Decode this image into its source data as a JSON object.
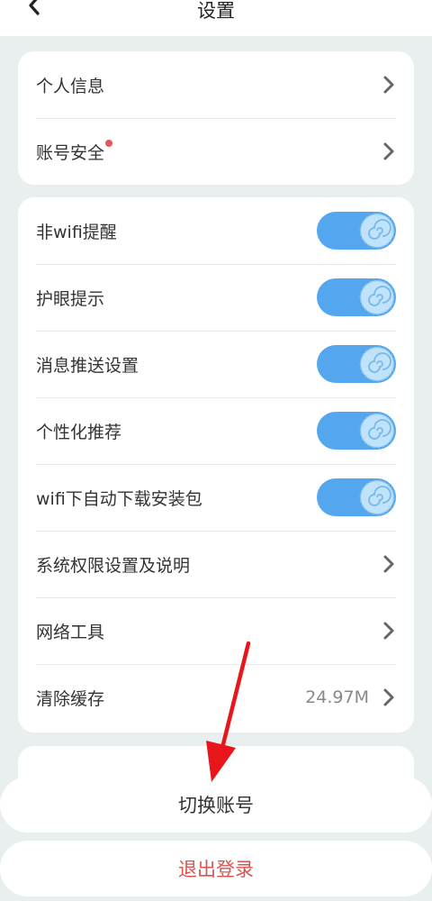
{
  "header": {
    "title": "设置",
    "back_icon": "chevron-left-icon"
  },
  "account_section": {
    "items": [
      {
        "label": "个人信息",
        "icon": "chevron-right-icon"
      },
      {
        "label": "账号安全",
        "icon": "chevron-right-icon",
        "badge": "red-dot"
      }
    ]
  },
  "settings_section": {
    "toggles": [
      {
        "label": "非wifi提醒",
        "on": true
      },
      {
        "label": "护眼提示",
        "on": true
      },
      {
        "label": "消息推送设置",
        "on": true
      },
      {
        "label": "个性化推荐",
        "on": true
      },
      {
        "label": "wifi下自动下载安装包",
        "on": true
      }
    ],
    "links": [
      {
        "label": "系统权限设置及说明",
        "icon": "chevron-right-icon"
      },
      {
        "label": "网络工具",
        "icon": "chevron-right-icon"
      },
      {
        "label": "清除缓存",
        "value": "24.97M",
        "icon": "chevron-right-icon"
      }
    ]
  },
  "actions": {
    "switch_account_label": "切换账号",
    "logout_label": "退出登录"
  },
  "colors": {
    "background": "#e9eeee",
    "toggle_on": "#54a7ee",
    "logout_text": "#d9534f",
    "badge": "#e9565a",
    "annotation_arrow": "#e8161b"
  }
}
